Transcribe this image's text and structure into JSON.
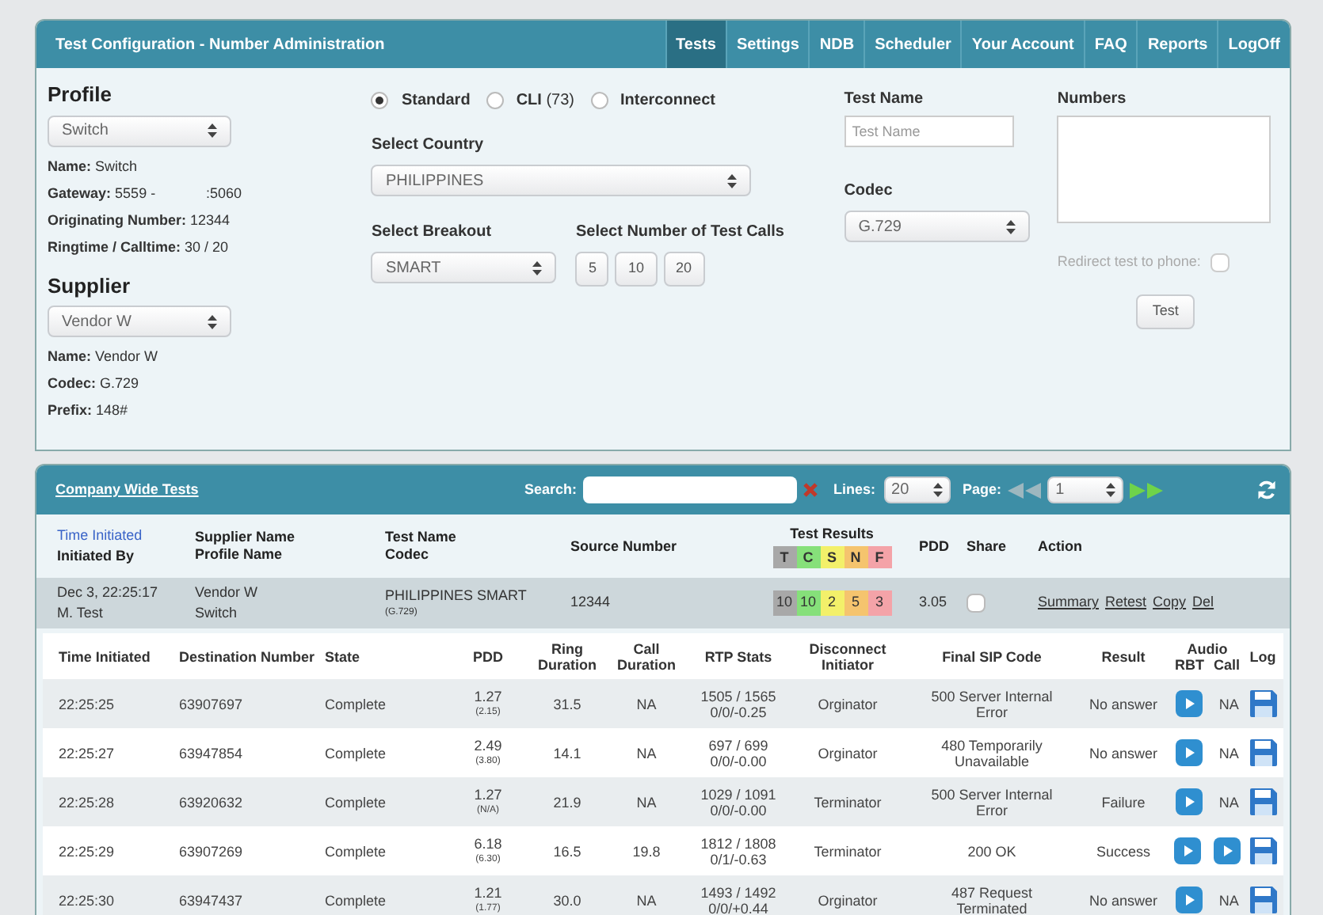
{
  "window": {
    "title": "Test Configuration - Number Administration"
  },
  "nav": [
    {
      "label": "Tests",
      "selected": true
    },
    {
      "label": "Settings",
      "selected": false
    },
    {
      "label": "NDB",
      "selected": false
    },
    {
      "label": "Scheduler",
      "selected": false
    },
    {
      "label": "Your Account",
      "selected": false
    },
    {
      "label": "FAQ",
      "selected": false
    },
    {
      "label": "Reports",
      "selected": false
    },
    {
      "label": "LogOff",
      "selected": false
    }
  ],
  "profile": {
    "heading": "Profile",
    "value": "Switch",
    "info": [
      {
        "label": "Name:",
        "value": "Switch"
      },
      {
        "label": "Gateway:",
        "value": "5559 -",
        "extra": ":5060"
      },
      {
        "label": "Originating Number:",
        "value": "12344"
      },
      {
        "label": "Ringtime / Calltime:",
        "value": "30 / 20"
      }
    ]
  },
  "supplier": {
    "heading": "Supplier",
    "value": "Vendor W",
    "info": [
      {
        "label": "Name:",
        "value": "Vendor W"
      },
      {
        "label": "Codec:",
        "value": "G.729"
      },
      {
        "label": "Prefix:",
        "value": "148#"
      }
    ]
  },
  "route_types": [
    {
      "label": "Standard",
      "selected": true
    },
    {
      "label": "CLI",
      "count": "(73)",
      "selected": false
    },
    {
      "label": "Interconnect",
      "selected": false
    }
  ],
  "country": {
    "label": "Select Country",
    "value": "PHILIPPINES"
  },
  "breakout": {
    "label": "Select Breakout",
    "value": "SMART"
  },
  "test_calls": {
    "label": "Select Number of Test Calls",
    "options": [
      "5",
      "10",
      "20"
    ]
  },
  "test_name": {
    "label": "Test Name",
    "placeholder": "Test Name"
  },
  "codec": {
    "label": "Codec",
    "value": "G.729"
  },
  "numbers": {
    "label": "Numbers"
  },
  "redirect": {
    "label": "Redirect test to phone:",
    "checked": false
  },
  "test_button": "Test",
  "tests": {
    "title": "Company Wide Tests",
    "search_label": "Search:",
    "lines_label": "Lines:",
    "lines_value": "20",
    "page_label": "Page:",
    "page_value": "1",
    "summary_columns": [
      {
        "kind": "sort",
        "lines": [
          "Time Initiated",
          "Initiated By"
        ]
      },
      {
        "kind": "plain",
        "lines": [
          "Supplier Name",
          "Profile Name"
        ]
      },
      {
        "kind": "plain",
        "lines": [
          "Test Name",
          "Codec"
        ]
      },
      {
        "kind": "plain",
        "lines": [
          "Source Number"
        ]
      },
      {
        "kind": "results",
        "lines": [
          "Test Results"
        ],
        "keys": [
          {
            "label": "T",
            "color": "#a8a8a8"
          },
          {
            "label": "C",
            "color": "#86e07a"
          },
          {
            "label": "S",
            "color": "#f3f06a"
          },
          {
            "label": "N",
            "color": "#f5c46e"
          },
          {
            "label": "F",
            "color": "#f4a3a8"
          }
        ]
      },
      {
        "kind": "plain",
        "lines": [
          "PDD"
        ]
      },
      {
        "kind": "plain",
        "lines": [
          "Share"
        ]
      },
      {
        "kind": "plain",
        "lines": [
          "Action"
        ]
      }
    ],
    "summary": {
      "time": "Dec 3, 22:25:17",
      "initiated_by": "M. Test",
      "supplier": "Vendor W",
      "profile": "Switch",
      "test_name": "PHILIPPINES SMART",
      "codec": "(G.729)",
      "source": "12344",
      "results": [
        "10",
        "10",
        "2",
        "5",
        "3"
      ],
      "pdd": "3.05",
      "shared": false,
      "actions": [
        "Summary",
        "Retest",
        "Copy",
        "Del"
      ]
    },
    "detail_columns": [
      "Time Initiated",
      "Destination Number",
      "State",
      "PDD",
      "Ring Duration",
      "Call Duration",
      "RTP Stats",
      "Disconnect Initiator",
      "Final SIP Code",
      "Result"
    ],
    "audio_header": {
      "title": "Audio",
      "rbt": "RBT",
      "call": "Call"
    },
    "log_header": "Log",
    "rows": [
      {
        "time": "22:25:25",
        "destination": "63907697",
        "state": "Complete",
        "pdd": "1.27",
        "pdd_sub": "(2.15)",
        "ring": "31.5",
        "call": "NA",
        "rtp": [
          "1505 / 1565",
          "0/0/-0.25"
        ],
        "initiator": "Orginator",
        "sip": "500 Server Internal Error",
        "result": "No answer",
        "rbt": {
          "kind": "play"
        },
        "call_audio": {
          "kind": "text",
          "text": "NA"
        }
      },
      {
        "time": "22:25:27",
        "destination": "63947854",
        "state": "Complete",
        "pdd": "2.49",
        "pdd_sub": "(3.80)",
        "ring": "14.1",
        "call": "NA",
        "rtp": [
          "697 / 699",
          "0/0/-0.00"
        ],
        "initiator": "Orginator",
        "sip": "480 Temporarily Unavailable",
        "result": "No answer",
        "rbt": {
          "kind": "play"
        },
        "call_audio": {
          "kind": "text",
          "text": "NA"
        }
      },
      {
        "time": "22:25:28",
        "destination": "63920632",
        "state": "Complete",
        "pdd": "1.27",
        "pdd_sub": "(N/A)",
        "ring": "21.9",
        "call": "NA",
        "rtp": [
          "1029 / 1091",
          "0/0/-0.00"
        ],
        "initiator": "Terminator",
        "sip": "500 Server Internal Error",
        "result": "Failure",
        "rbt": {
          "kind": "play"
        },
        "call_audio": {
          "kind": "text",
          "text": "NA"
        }
      },
      {
        "time": "22:25:29",
        "destination": "63907269",
        "state": "Complete",
        "pdd": "6.18",
        "pdd_sub": "(6.30)",
        "ring": "16.5",
        "call": "19.8",
        "rtp": [
          "1812 / 1808",
          "0/1/-0.63"
        ],
        "initiator": "Terminator",
        "sip": "200 OK",
        "result": "Success",
        "rbt": {
          "kind": "play"
        },
        "call_audio": {
          "kind": "play"
        }
      },
      {
        "time": "22:25:30",
        "destination": "63947437",
        "state": "Complete",
        "pdd": "1.21",
        "pdd_sub": "(1.77)",
        "ring": "30.0",
        "call": "NA",
        "rtp": [
          "1493 / 1492",
          "0/0/+0.44"
        ],
        "initiator": "Orginator",
        "sip": "487 Request Terminated",
        "result": "No answer",
        "rbt": {
          "kind": "play"
        },
        "call_audio": {
          "kind": "text",
          "text": "NA"
        }
      }
    ]
  }
}
